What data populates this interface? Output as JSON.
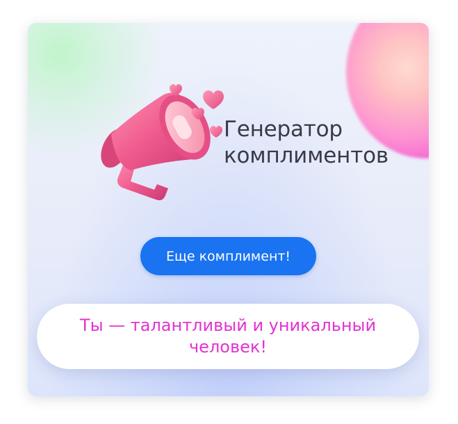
{
  "app": {
    "title_line1": "Генератор",
    "title_line2": "комплиментов"
  },
  "actions": {
    "next_button_label": "Еще комплимент!"
  },
  "compliment": {
    "text": "Ты — талантливый и уникальный человек!"
  },
  "icons": {
    "logo": "megaphone-with-hearts-icon"
  },
  "colors": {
    "button_background": "#1a73f0",
    "button_text": "#ffffff",
    "compliment_text": "#e233cf",
    "title_text": "#3a3a48",
    "megaphone_pink": "#ef5a8e"
  }
}
